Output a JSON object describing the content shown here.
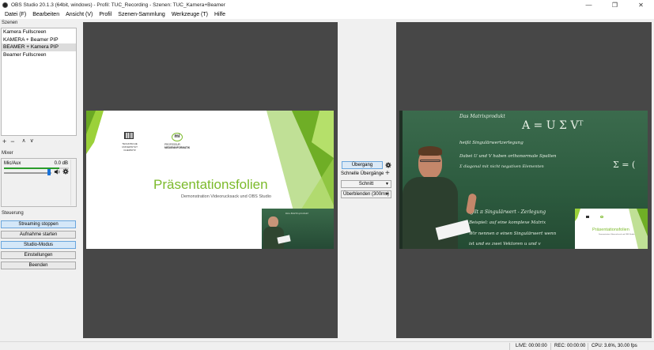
{
  "window": {
    "title": "OBS Studio 20.1.3 (64bit, windows) - Profil: TUC_Recording - Szenen: TUC_Kamera+Beamer",
    "controls": [
      "—",
      "❐",
      "✕"
    ]
  },
  "menu": [
    "Datei (F)",
    "Bearbeiten",
    "Ansicht (V)",
    "Profil",
    "Szenen-Sammlung",
    "Werkzeuge (T)",
    "Hilfe"
  ],
  "scenes": {
    "title": "Szenen",
    "items": [
      "Kamera Fullscreen",
      "KAMERA + Beamer PIP",
      "BEAMER + Kamera PIP",
      "Beamer Fullscreen"
    ],
    "selected_index": 2,
    "toolbar": [
      "+",
      "−",
      "∧",
      "∨"
    ]
  },
  "mixer": {
    "title": "Mixer",
    "source": "Mic/Aux",
    "db": "0.0 dB",
    "level": 0.85
  },
  "controls": {
    "title": "Steuerung",
    "buttons": [
      "Streaming stoppen",
      "Aufnahme starten",
      "Studio-Modus",
      "Einstellungen",
      "Beenden"
    ]
  },
  "preview": {
    "slide": {
      "title": "Präsentationsfolien",
      "subtitle": "Demonstration Videorucksack und OBS Studio",
      "logo1": "TECHNISCHE UNIVERSITÄT CHEMNITZ",
      "logo2_line1": "PROFESSUR",
      "logo2_line2": "MEDIENINFORMATIK",
      "logo2_mark": "mi"
    },
    "board_text": "Das Matrixprodukt"
  },
  "program": {
    "board": {
      "line1": "Das Matrixprodukt",
      "formula": "A = U Σ Vᵀ",
      "line2": "heißt Singulärwertzerlegung",
      "line3": "Dabei U und V haben orthonormale Spalten",
      "line4": "Σ diagonal mit nicht negativen Elementen",
      "line5": "Σ = (",
      "line6": "gilt π Singulärwert - Zerlegung",
      "line7": "Beispiel: auf eine komplexe Matrix",
      "line8": "Wir nennen σ einen Singulärwert wenn",
      "line9": "ist und es zwei Vektoren u und v"
    },
    "pip_slide_title": "Präsentationsfolien",
    "pip_slide_sub": "Demonstration Videorucksack und OBS Studio"
  },
  "transition": {
    "button": "Übergang",
    "quick_label": "Schnelle Übergänge",
    "select1": "Schnitt",
    "select2": "Überblenden (300ms)"
  },
  "status": {
    "live": "LIVE: 00:00:00",
    "rec": "REC: 00:00:00",
    "cpu": "CPU: 3.6%, 30.00 fps"
  }
}
